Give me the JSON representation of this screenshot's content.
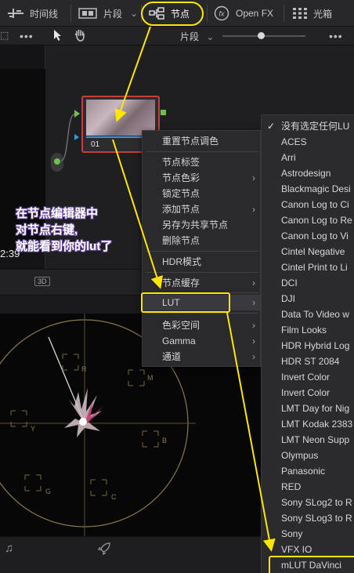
{
  "toolbar": {
    "timeline_label": "时间线",
    "clips_label": "片段",
    "nodes_label": "节点",
    "openfx_label": "Open FX",
    "lightbox_label": "光箱"
  },
  "subbar": {
    "more_label": "•••",
    "clips_label": "片段",
    "more_label_right": "•••"
  },
  "viewer": {
    "timecode": "2:39",
    "badge": "3D"
  },
  "node": {
    "label": "01"
  },
  "annotation": {
    "line1": "在节点编辑器中",
    "line2": "对节点右键,",
    "line3": "就能看到你的lut了"
  },
  "context_menu": {
    "items": [
      {
        "label": "重置节点调色",
        "submenu": false
      },
      {
        "label": "节点标签",
        "submenu": false
      },
      {
        "label": "节点色彩",
        "submenu": true
      },
      {
        "label": "锁定节点",
        "submenu": false
      },
      {
        "label": "添加节点",
        "submenu": true
      },
      {
        "label": "另存为共享节点",
        "submenu": false
      },
      {
        "label": "删除节点",
        "submenu": false
      },
      {
        "label": "HDR模式",
        "submenu": false
      },
      {
        "label": "节点缓存",
        "submenu": true
      },
      {
        "label": "LUT",
        "submenu": true
      },
      {
        "label": "色彩空间",
        "submenu": true
      },
      {
        "label": "Gamma",
        "submenu": true
      },
      {
        "label": "通道",
        "submenu": true
      }
    ]
  },
  "lut_menu": {
    "items": [
      "没有选定任何LU",
      "ACES",
      "Arri",
      "Astrodesign",
      "Blackmagic Desi",
      "Canon Log to Ci",
      "Canon Log to Re",
      "Canon Log to Vi",
      "Cintel Negative",
      "Cintel Print to Li",
      "DCI",
      "DJI",
      "Data To Video w",
      "Film Looks",
      "HDR Hybrid Log",
      "HDR ST 2084",
      "Invert Color",
      "Invert Color",
      "LMT Day for Nig",
      "LMT Kodak 2383",
      "LMT Neon Supp",
      "Olympus",
      "Panasonic",
      "RED",
      "Sony SLog2 to R",
      "Sony SLog3 to R",
      "Sony",
      "VFX IO",
      "mLUT DaVinci"
    ],
    "checked_index": 0
  },
  "scope": {
    "labels": {
      "r": "R",
      "m": "M",
      "y": "Y",
      "b": "B",
      "g": "G",
      "c": "C"
    }
  },
  "colors": {
    "highlight": "#ffe600",
    "node_border": "#c3403a",
    "annotation_outline": "#6a4a9a"
  }
}
